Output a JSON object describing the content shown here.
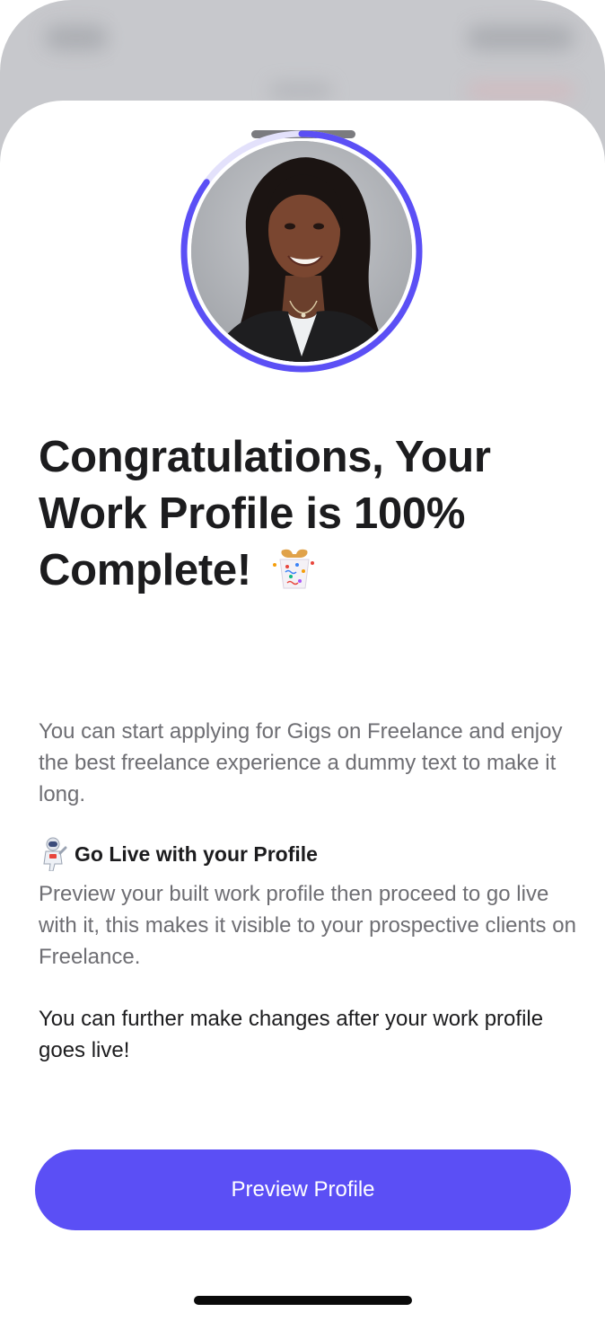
{
  "sheet": {
    "handle_icon": "drag-handle"
  },
  "profile": {
    "avatar_alt": "Profile photo",
    "completion_fraction": 0.85,
    "ring_color": "#5b4ff5",
    "ring_track_color": "#e3e1fb"
  },
  "content": {
    "headline": "Congratulations, Your Work Profile is 100% Complete!",
    "headline_icon": "confetti-popper",
    "intro": "You can start applying for Gigs on Freelance and enjoy the best freelance experience a dummy text to make it long.",
    "go_live": {
      "icon": "astronaut",
      "title": "Go Live with your Profile",
      "description": "Preview your built work profile then proceed to go live with it, this makes it visible to your prospective clients on Freelance."
    },
    "note": "You can further make changes after your work profile goes live!"
  },
  "actions": {
    "preview_label": "Preview Profile"
  },
  "colors": {
    "accent": "#5b4ff5",
    "muted_text": "#6e6e73",
    "primary_text": "#1c1c1e"
  }
}
